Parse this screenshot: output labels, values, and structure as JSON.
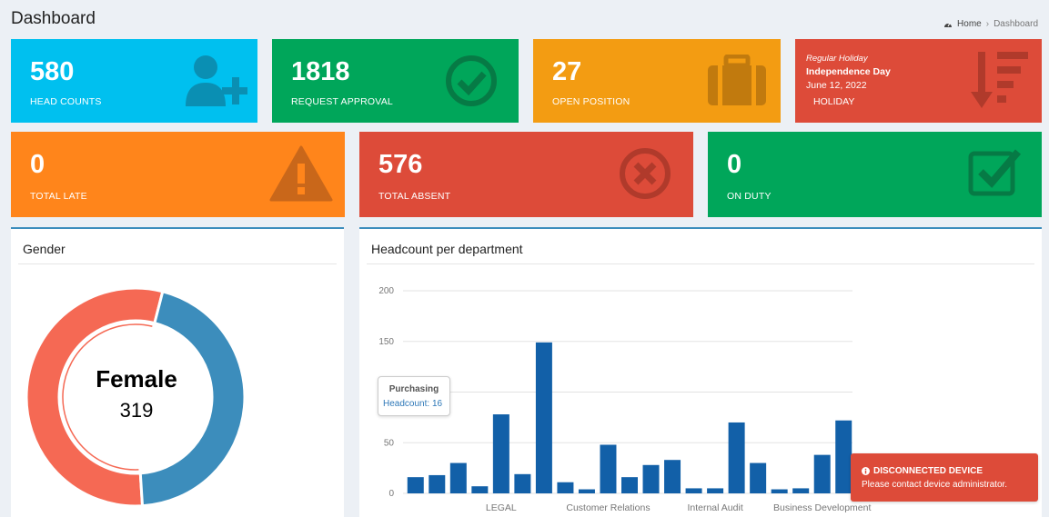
{
  "page": {
    "title": "Dashboard"
  },
  "breadcrumb": {
    "home": "Home",
    "current": "Dashboard"
  },
  "stats": [
    {
      "value": "580",
      "label": "HEAD COUNTS",
      "color": "#00c0ef",
      "icon": "add-user-icon"
    },
    {
      "value": "1818",
      "label": "REQUEST APPROVAL",
      "color": "#00a65a",
      "icon": "check-circle-icon"
    },
    {
      "value": "27",
      "label": "OPEN POSITION",
      "color": "#f39c12",
      "icon": "briefcase-icon"
    },
    {
      "value": "0",
      "label": "TOTAL LATE",
      "color": "#ff851b",
      "icon": "warning-icon"
    },
    {
      "value": "576",
      "label": "TOTAL ABSENT",
      "color": "#dd4b39",
      "icon": "times-circle-icon"
    },
    {
      "value": "0",
      "label": "ON DUTY",
      "color": "#00a65a",
      "icon": "check-square-icon"
    }
  ],
  "holiday": {
    "type": "Regular Holiday",
    "name": "Independence Day",
    "date": "June 12, 2022",
    "label": "HOLIDAY",
    "color": "#dd4b39",
    "icon": "sort-amount-down-icon"
  },
  "gender_panel": {
    "title": "Gender",
    "center_label": "Female",
    "center_value": "319"
  },
  "headcount_panel": {
    "title": "Headcount per department"
  },
  "chart_data": [
    {
      "type": "pie",
      "title": "Gender",
      "slices": [
        {
          "name": "Female",
          "value": 319,
          "color": "#f56954"
        },
        {
          "name": "",
          "value": 261,
          "color": "#3c8dbc"
        }
      ]
    },
    {
      "type": "bar",
      "title": "Headcount per department",
      "visible_category_labels": [
        "LEGAL",
        "Customer Relations",
        "Internal Audit",
        "Business Development"
      ],
      "values": [
        16,
        18,
        30,
        7,
        78,
        19,
        149,
        11,
        4,
        48,
        16,
        28,
        33,
        5,
        5,
        70,
        30,
        4,
        5,
        38,
        72
      ],
      "yticks": [
        "200",
        "150",
        "100",
        "50",
        "0"
      ],
      "ylim": [
        0,
        200
      ],
      "color": "#1260a8",
      "tooltip": {
        "category": "Purchasing",
        "label": "Headcount",
        "value": "16"
      }
    }
  ],
  "alert": {
    "title": "DISCONNECTED DEVICE",
    "message": "Please contact device administrator."
  }
}
